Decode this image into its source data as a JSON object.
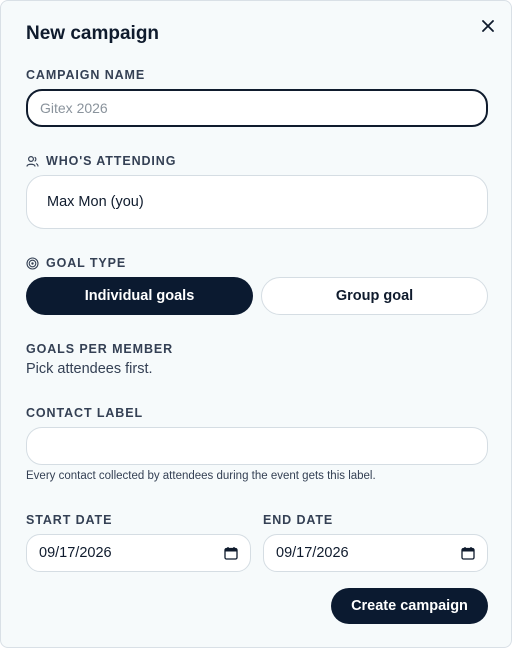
{
  "dialog": {
    "title": "New campaign",
    "close_icon": "close-icon"
  },
  "campaign_name": {
    "label": "CAMPAIGN NAME",
    "value": "",
    "placeholder": "Gitex 2026"
  },
  "attending": {
    "label": "WHO'S ATTENDING",
    "icon": "users-icon",
    "selected": "Max Mon (you)"
  },
  "goal_type": {
    "label": "GOAL TYPE",
    "icon": "target-icon",
    "options": [
      "Individual goals",
      "Group goal"
    ],
    "selected": "Individual goals"
  },
  "goals_per_member": {
    "label": "GOALS PER MEMBER",
    "hint": "Pick attendees first."
  },
  "contact_label": {
    "label": "CONTACT LABEL",
    "value": "",
    "hint": "Every contact collected by attendees during the event gets this label."
  },
  "dates": {
    "start_label": "START DATE",
    "start_value": "09/17/2026",
    "end_label": "END DATE",
    "end_value": "09/17/2026",
    "calendar_icon": "calendar-icon"
  },
  "actions": {
    "create_label": "Create campaign"
  },
  "colors": {
    "primary": "#0b1a30",
    "background": "#f6fafb",
    "border": "#d5dde3",
    "label": "#344054"
  }
}
